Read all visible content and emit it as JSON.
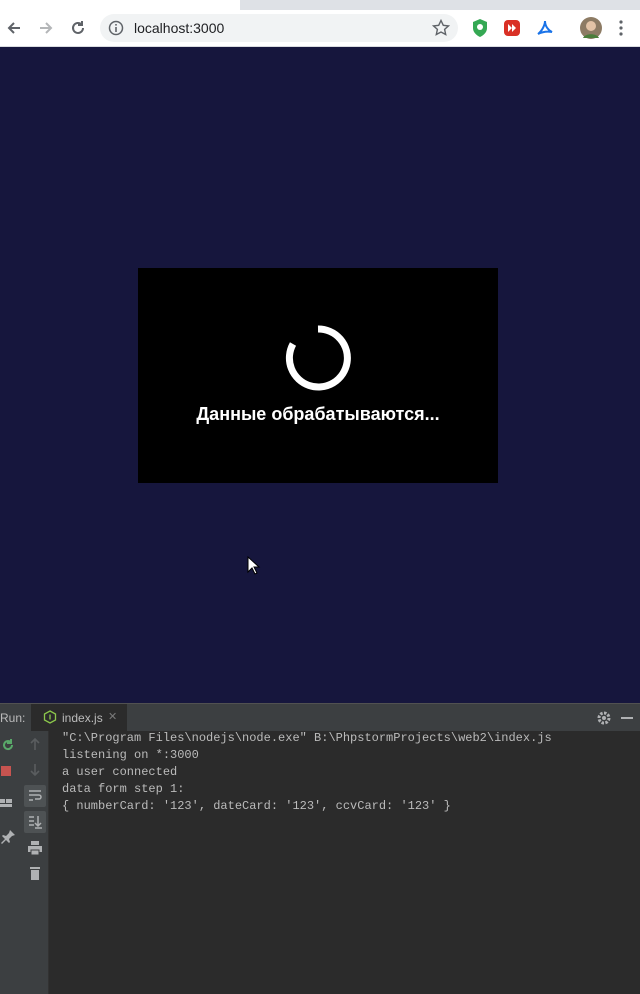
{
  "browser": {
    "url": "localhost:3000",
    "icons": [
      "back-arrow-icon",
      "forward-arrow-icon",
      "reload-icon",
      "site-info-icon",
      "bookmark-star-icon",
      "shield-extension-icon",
      "media-extension-icon",
      "acrobat-extension-icon",
      "profile-avatar"
    ]
  },
  "modal": {
    "message": "Данные обрабатываются..."
  },
  "ide": {
    "run_label": "Run:",
    "tab_label": "index.js",
    "tab_close": "✕",
    "console_lines": [
      "\"C:\\Program Files\\nodejs\\node.exe\" B:\\PhpstormProjects\\web2\\index.js",
      "listening on *:3000",
      "a user connected",
      "data form step 1:",
      "{ numberCard: '123', dateCard: '123', ccvCard: '123' }"
    ]
  },
  "colors": {
    "page_bg": "#16163d",
    "modal_bg": "#000000",
    "console_bg": "#2b2b2b",
    "console_text": "#bbbbbb"
  }
}
